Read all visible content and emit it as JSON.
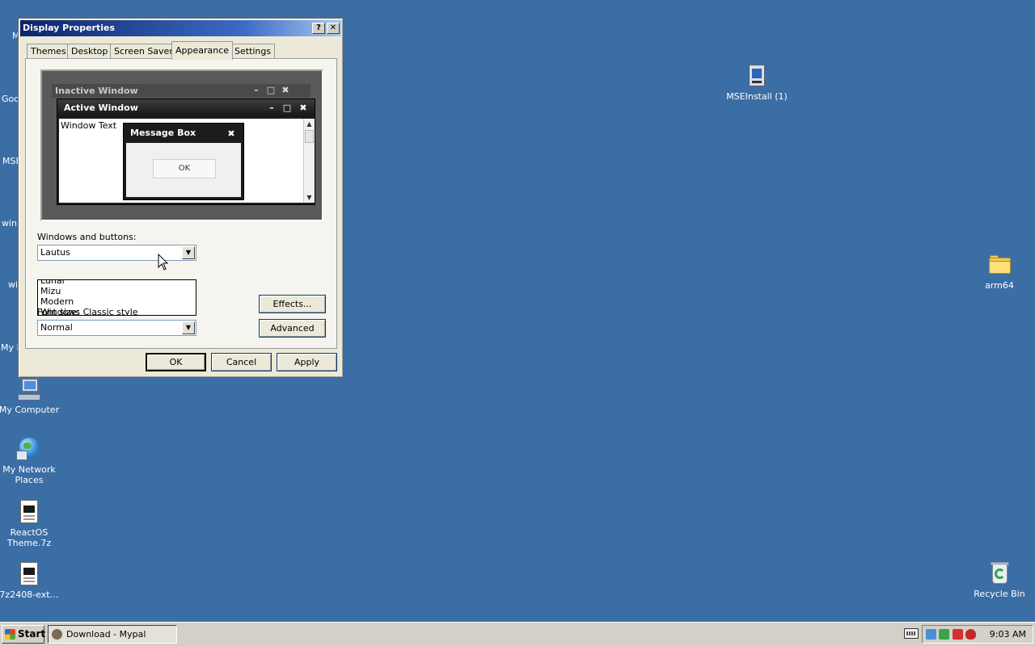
{
  "desktop": {
    "icons": [
      {
        "label": "My Computer",
        "icon": "my-computer-icon"
      },
      {
        "label": "My Network Places",
        "icon": "network-places-icon"
      },
      {
        "label": "ReactOS Theme.7z",
        "icon": "archive-file-icon"
      },
      {
        "label": "7z2408-ext…",
        "icon": "archive-file-icon"
      },
      {
        "label": "MSEInstall (1)",
        "icon": "setup-icon"
      },
      {
        "label": "arm64",
        "icon": "folder-icon"
      },
      {
        "label": "Recycle Bin",
        "icon": "recycle-bin-icon"
      }
    ],
    "partial_labels": [
      "M",
      "Goo",
      "MSE",
      "win",
      "wi",
      "My D"
    ]
  },
  "window": {
    "title": "Display Properties",
    "help_glyph": "?",
    "close_glyph": "✕",
    "tabs": [
      {
        "label": "Themes",
        "active": false
      },
      {
        "label": "Desktop",
        "active": false
      },
      {
        "label": "Screen Saver",
        "active": false
      },
      {
        "label": "Appearance",
        "active": true
      },
      {
        "label": "Settings",
        "active": false
      }
    ],
    "preview": {
      "inactive_title": "Inactive Window",
      "active_title": "Active Window",
      "window_text": "Window Text",
      "message_box_title": "Message Box",
      "message_box_ok": "OK",
      "min_glyph": "–",
      "max_glyph": "□",
      "close_glyph": "✖",
      "scroll_up": "▲",
      "scroll_down": "▼"
    },
    "windows_and_buttons": {
      "label": "Windows and buttons:",
      "selected": "Lautus",
      "options_visible": [
        "Lunar",
        "Mizu",
        "Modern",
        "Windows Classic style"
      ]
    },
    "font_size": {
      "label": "Font size:",
      "selected": "Normal"
    },
    "dropdown_glyph": "▼",
    "effects_button": "Effects...",
    "advanced_button": "Advanced",
    "ok_button": "OK",
    "cancel_button": "Cancel",
    "apply_button": "Apply"
  },
  "taskbar": {
    "start_label": "Start",
    "task_item": "Download - Mypal",
    "clock": "9:03 AM"
  },
  "colors": {
    "desktop_bg": "#3a6ea5",
    "titlebar_start": "#0a246a",
    "titlebar_end": "#a6caf0",
    "window_face": "#ece9d8"
  }
}
